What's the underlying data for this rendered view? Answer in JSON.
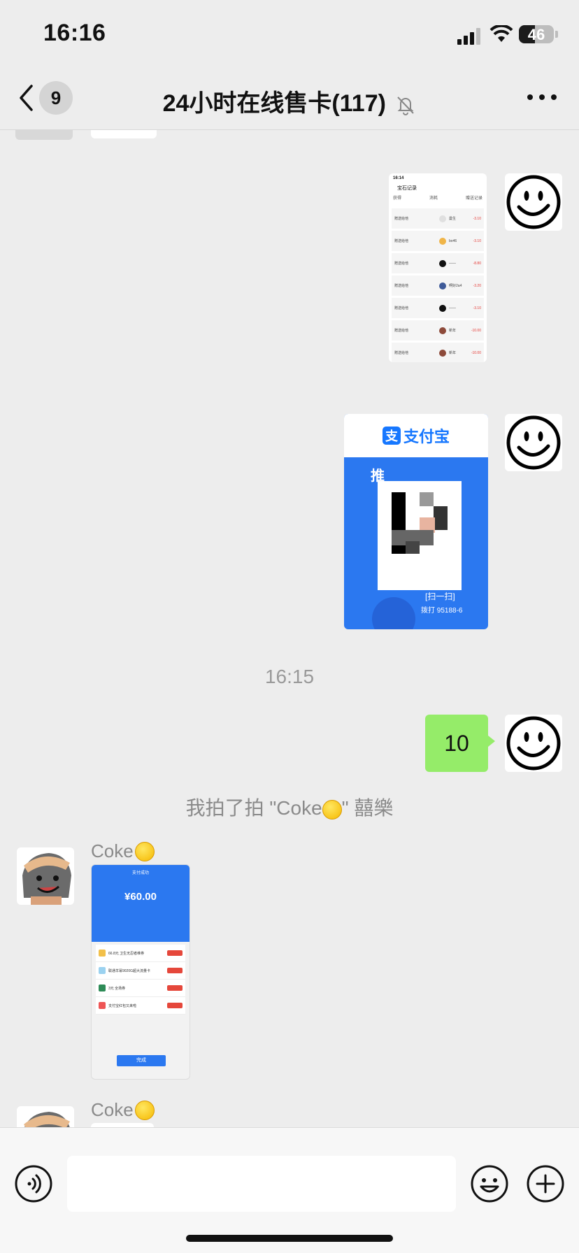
{
  "status_bar": {
    "time": "16:16",
    "battery_level": "46"
  },
  "header": {
    "unread_count": "9",
    "title": "24小时在线售卡(117)"
  },
  "messages": {
    "gem_record_thumb": {
      "time": "16:14",
      "title": "宝石记录",
      "tabs": [
        "获得",
        "消耗",
        "赠送记录"
      ],
      "rows": [
        {
          "label": "赠送给他",
          "name": "曼生",
          "amount": "-3.10"
        },
        {
          "label": "赠送给他",
          "name": "bo46",
          "amount": "-3.10"
        },
        {
          "label": "赠送给他",
          "name": "——",
          "amount": "-8.80"
        },
        {
          "label": "赠送给他",
          "name": "啊好2a4",
          "amount": "-3.20"
        },
        {
          "label": "赠送给他",
          "name": "——",
          "amount": "-3.10"
        },
        {
          "label": "赠送给他",
          "name": "新年",
          "amount": "-10.00"
        },
        {
          "label": "赠送给他",
          "name": "新年",
          "amount": "-10.00"
        }
      ]
    },
    "alipay_card": {
      "brand": "支付宝",
      "promo": "推",
      "scan_hint": "扫一扫",
      "hotline": "拨打 95188-6"
    },
    "timestamp": "16:15",
    "my_text": "10",
    "pat_notice": {
      "before": "我拍了拍 \"Coke",
      "after": "\" 囍樂"
    },
    "sender1": {
      "name": "Coke"
    },
    "payment_thumb": {
      "status": "支付成功",
      "amount": "¥60.00",
      "items": [
        "66.8元 卫生无忍者维券",
        "联通羊幂9020G超大流量卡",
        "3元 全场券",
        "支付宝红包又来啦"
      ],
      "done_label": "完成"
    },
    "sender2": {
      "name": "Coke"
    }
  },
  "input": {
    "placeholder": ""
  },
  "colors": {
    "my_bubble": "#95ec69",
    "alipay_blue": "#1677ff",
    "background": "#ededed"
  }
}
